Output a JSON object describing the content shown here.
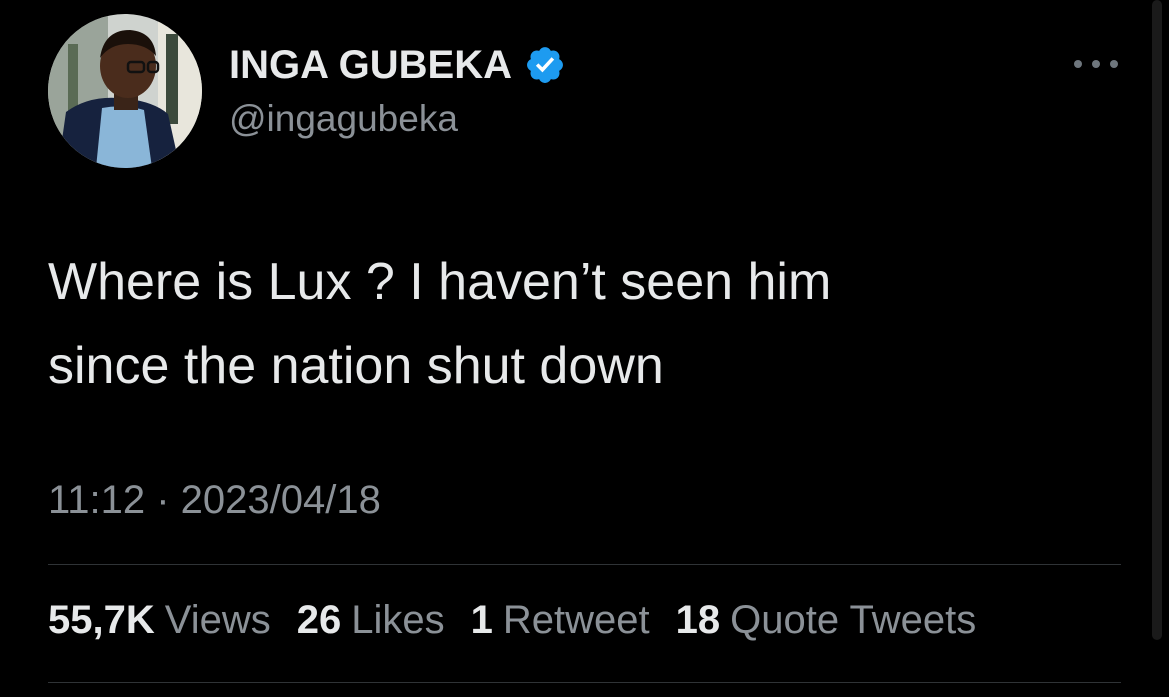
{
  "user": {
    "display_name": "INGA GUBEKA",
    "handle": "@ingagubeka",
    "verified": true
  },
  "tweet": {
    "text": "Where is Lux ? I haven’t seen him\nsince the nation shut down",
    "timestamp": "11:12 · 2023/04/18"
  },
  "stats": {
    "views_count": "55,7K",
    "views_label": "Views",
    "likes_count": "26",
    "likes_label": "Likes",
    "retweets_count": "1",
    "retweets_label": "Retweet",
    "quotes_count": "18",
    "quotes_label": "Quote Tweets"
  },
  "icons": {
    "verified": "verified-badge-icon",
    "more": "more-options-icon"
  },
  "colors": {
    "background": "#000000",
    "text_primary": "#e7e9ea",
    "text_secondary": "#8b9197",
    "verified_blue": "#1d9bf0",
    "divider": "#2f3336"
  }
}
